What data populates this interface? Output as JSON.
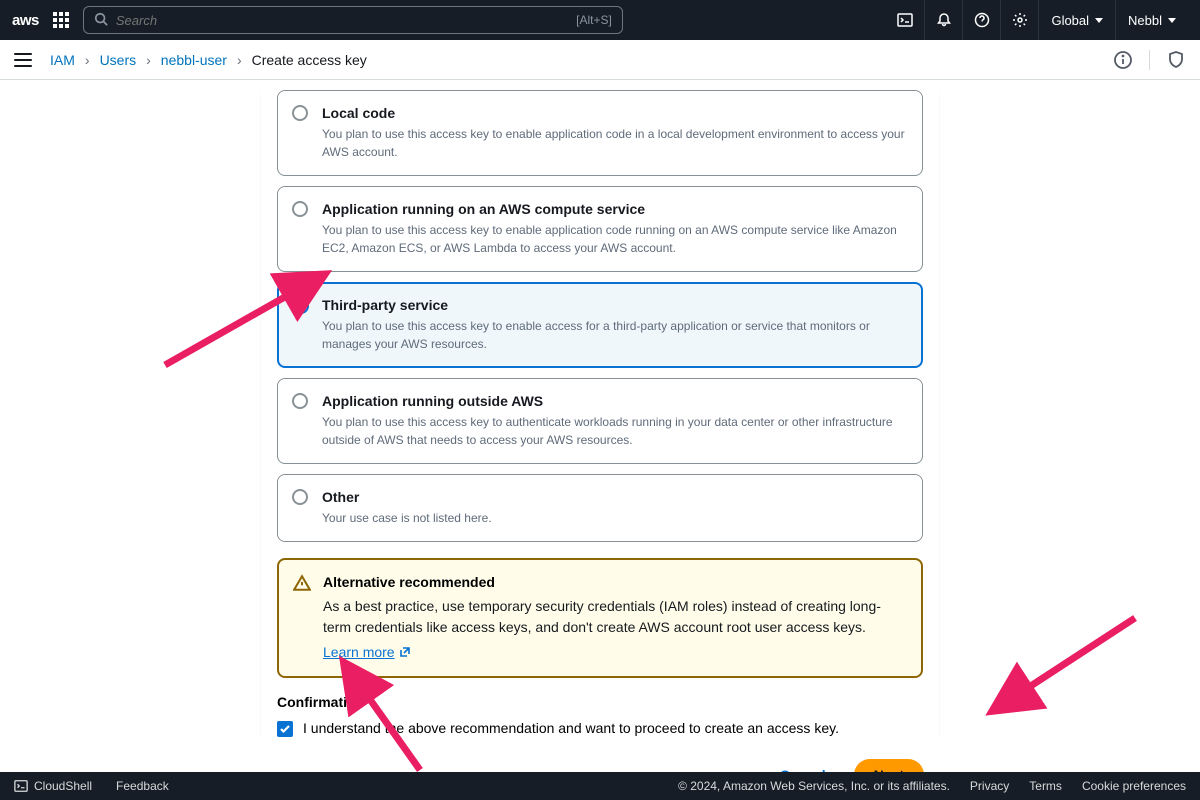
{
  "header": {
    "logo": "aws",
    "search_placeholder": "Search",
    "search_shortcut": "[Alt+S]",
    "region": "Global",
    "account": "Nebbl"
  },
  "breadcrumbs": {
    "service": "IAM",
    "section": "Users",
    "user": "nebbl-user",
    "page": "Create access key"
  },
  "options": [
    {
      "id": "local-code",
      "title": "Local code",
      "desc": "You plan to use this access key to enable application code in a local development environment to access your AWS account.",
      "selected": false
    },
    {
      "id": "compute-service",
      "title": "Application running on an AWS compute service",
      "desc": "You plan to use this access key to enable application code running on an AWS compute service like Amazon EC2, Amazon ECS, or AWS Lambda to access your AWS account.",
      "selected": false
    },
    {
      "id": "third-party",
      "title": "Third-party service",
      "desc": "You plan to use this access key to enable access for a third-party application or service that monitors or manages your AWS resources.",
      "selected": true
    },
    {
      "id": "outside-aws",
      "title": "Application running outside AWS",
      "desc": "You plan to use this access key to authenticate workloads running in your data center or other infrastructure outside of AWS that needs to access your AWS resources.",
      "selected": false
    },
    {
      "id": "other",
      "title": "Other",
      "desc": "Your use case is not listed here.",
      "selected": false
    }
  ],
  "alert": {
    "title": "Alternative recommended",
    "body": "As a best practice, use temporary security credentials (IAM roles) instead of creating long-term credentials like access keys, and don't create AWS account root user access keys.",
    "link": "Learn more"
  },
  "confirmation": {
    "heading": "Confirmation",
    "label": "I understand the above recommendation and want to proceed to create an access key.",
    "checked": true
  },
  "buttons": {
    "cancel": "Cancel",
    "next": "Next"
  },
  "footer": {
    "cloudshell": "CloudShell",
    "feedback": "Feedback",
    "copyright": "© 2024, Amazon Web Services, Inc. or its affiliates.",
    "privacy": "Privacy",
    "terms": "Terms",
    "cookies": "Cookie preferences"
  }
}
